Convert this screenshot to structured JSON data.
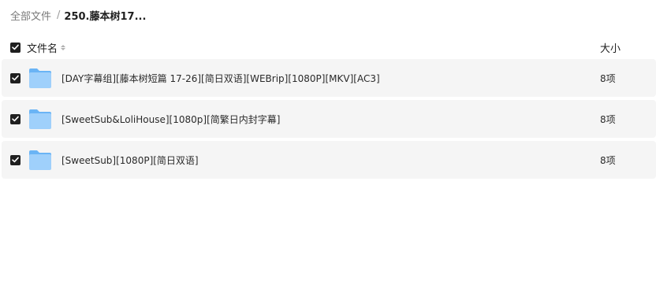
{
  "breadcrumb": {
    "root": "全部文件",
    "separator": "/",
    "current": "250.藤本树17..."
  },
  "header": {
    "name_label": "文件名",
    "size_label": "大小",
    "all_checked": true
  },
  "files": [
    {
      "name": "[DAY字幕组][藤本树短篇 17-26][简日双语][WEBrip][1080P][MKV][AC3]",
      "size": "8项",
      "type_icon": "folder-icon",
      "checked": true
    },
    {
      "name": "[SweetSub&LoliHouse][1080p][简繁日内封字幕]",
      "size": "8项",
      "type_icon": "folder-icon",
      "checked": true
    },
    {
      "name": "[SweetSub][1080P][简日双语]",
      "size": "8项",
      "type_icon": "folder-icon",
      "checked": true
    }
  ],
  "colors": {
    "row_background": "#f5f5f5",
    "checkbox": "#1f1f1f",
    "folder_light": "#9fd0fb",
    "folder_dark": "#6ab4f5"
  }
}
